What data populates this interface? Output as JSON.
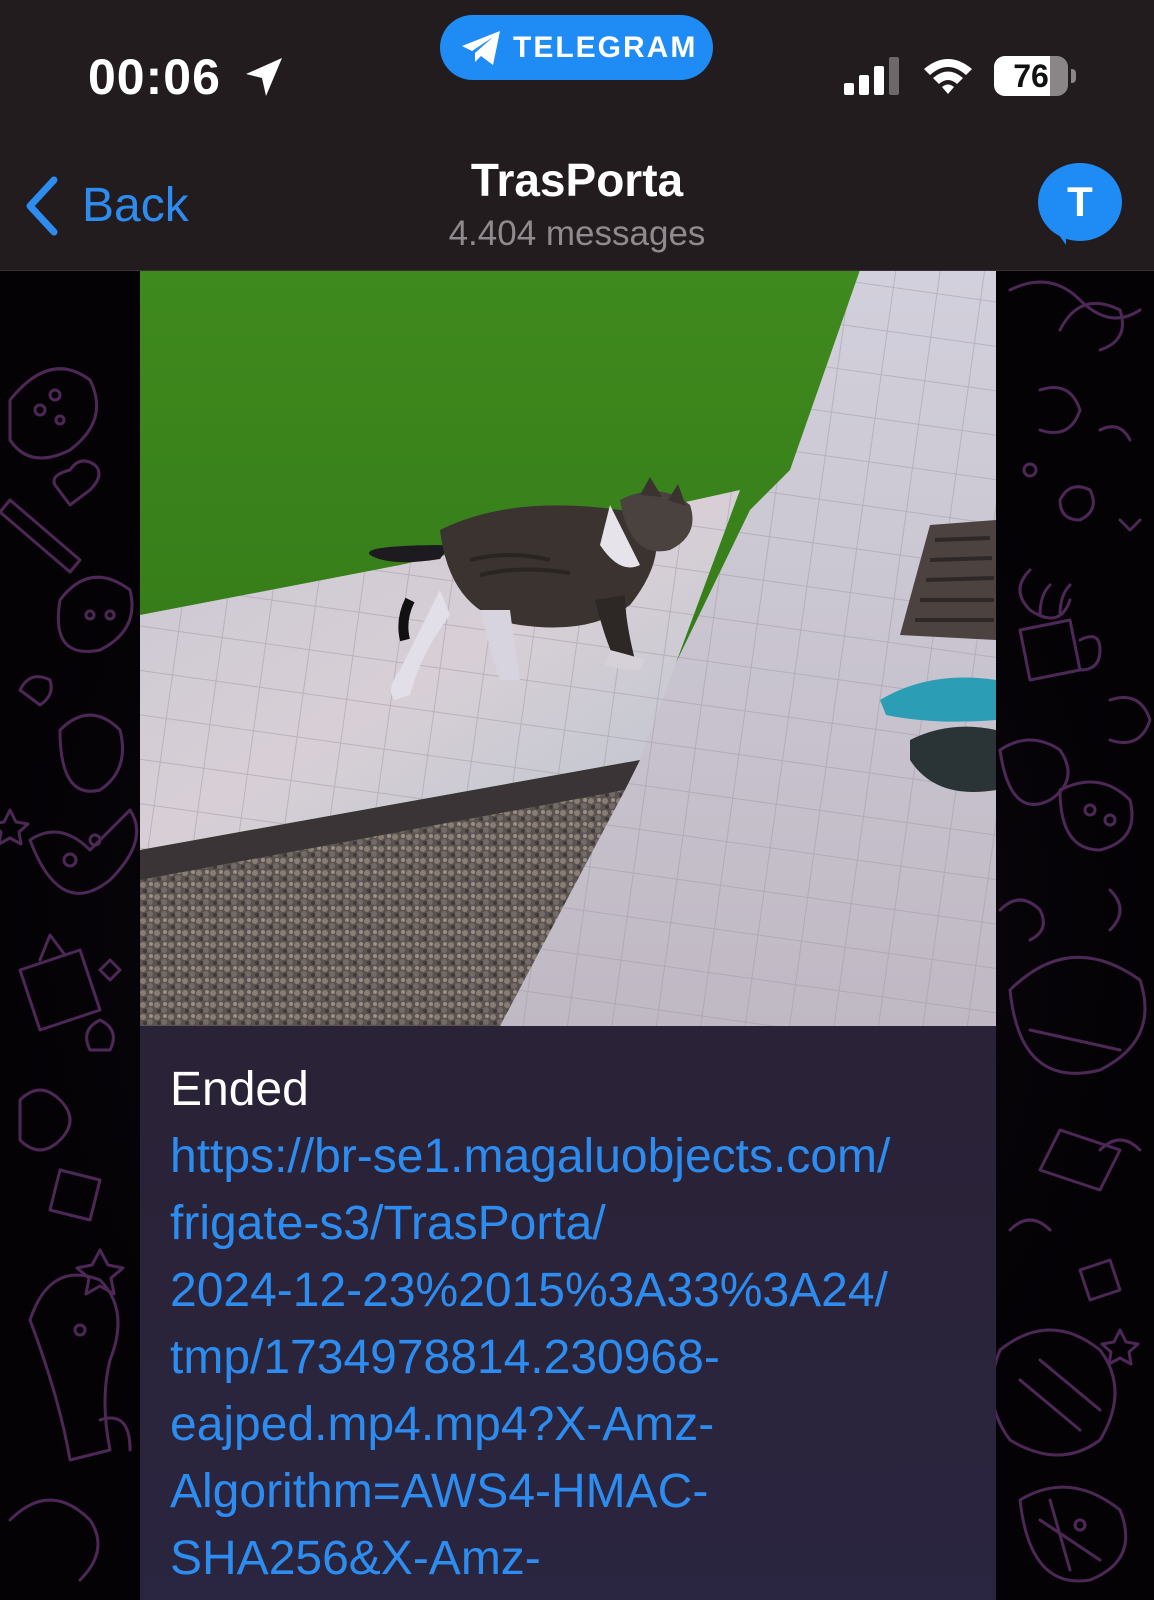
{
  "status_bar": {
    "time": "00:06",
    "return_app_label": "TELEGRAM",
    "battery_percent": "76",
    "battery_level": 0.76
  },
  "nav": {
    "back_label": "Back",
    "title": "TrasPorta",
    "subtitle": "4.404 messages",
    "avatar_letter": "T"
  },
  "message": {
    "status": "Ended",
    "link_lines": " https://br-se1.magaluobjects.com/\nfrigate-s3/TrasPorta/\n2024-12-23%2015%3A33%3A24/\ntmp/1734978814.230968-\neajped.mp4.mp4?X-Amz-\nAlgorithm=AWS4-HMAC-\nSHA256&X-Amz-"
  },
  "colors": {
    "accent": "#2d8cf0",
    "telegram_pill": "#1f8cf5",
    "header_bg": "#231c1f",
    "bubble_bg": "#2b2030"
  }
}
